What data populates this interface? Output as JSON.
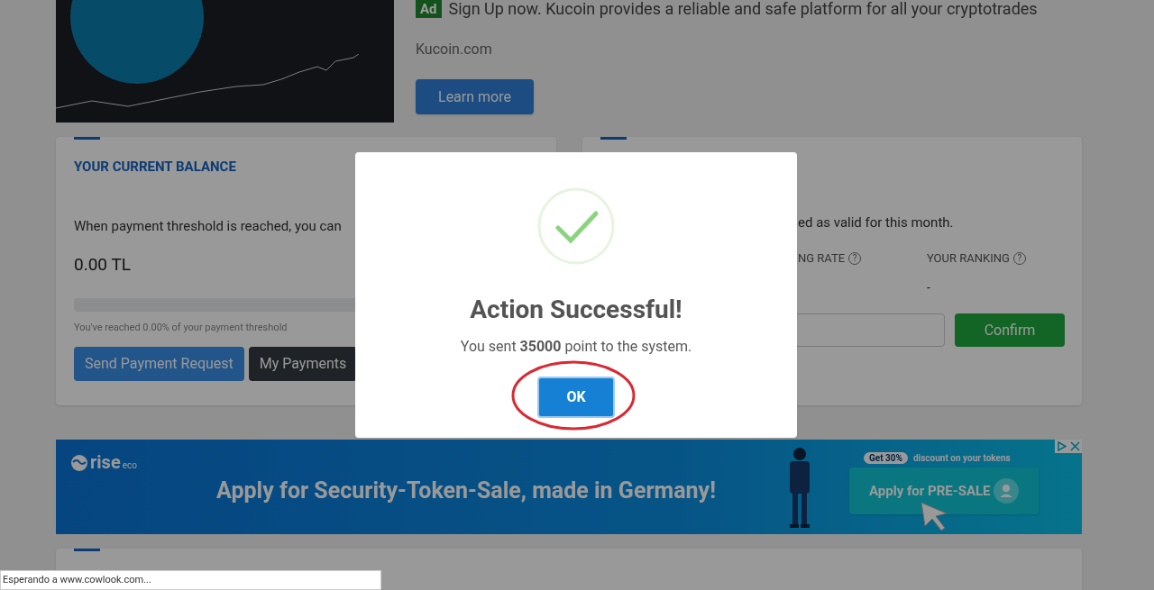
{
  "top_ad": {
    "badge": "Ad",
    "headline": "Sign Up now. Kucoin provides a reliable and safe platform for all your cryptotrades",
    "domain": "Kucoin.com",
    "button": "Learn more"
  },
  "balance_card": {
    "title": "YOUR CURRENT BALANCE",
    "description": "When payment threshold is reached, you can",
    "amount": "0.00 TL",
    "level": 0,
    "progress_caption": "You've reached 0.00% of your payment threshold",
    "buttons": [
      {
        "label": "Send Payment Request",
        "kind": "primary"
      },
      {
        "label": "My Payments",
        "kind": "dark"
      }
    ]
  },
  "points_card": {
    "description": "ed as valid for this month.",
    "stats": [
      {
        "label": "NG RATE",
        "help": "?"
      },
      {
        "label": "YOUR RANKING",
        "help": "?",
        "value": "-"
      }
    ],
    "button": "Confirm"
  },
  "banner": {
    "logo": "rise",
    "logo_suffix": "eco",
    "headline": "Apply for Security-Token-Sale, made in Germany!",
    "promo_badge": "Get 30%",
    "promo_text": "discount on your tokens",
    "cta": "Apply for PRE-SALE"
  },
  "modal": {
    "title": "Action Successful!",
    "message": "You sent **35000** point to the system.",
    "button": "OK"
  },
  "status_bar": "Esperando a www.cowlook.com..."
}
